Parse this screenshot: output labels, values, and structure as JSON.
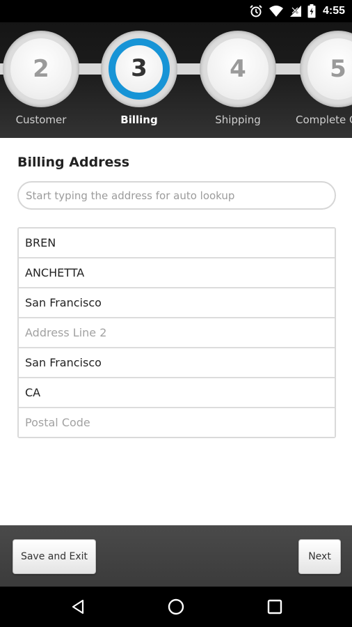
{
  "status_bar": {
    "time": "4:55",
    "icons": [
      "alarm-icon",
      "wifi-icon",
      "no-signal-icon",
      "battery-icon"
    ]
  },
  "stepper": {
    "steps": [
      {
        "number": "2",
        "label": "Customer",
        "active": false
      },
      {
        "number": "3",
        "label": "Billing",
        "active": true
      },
      {
        "number": "4",
        "label": "Shipping",
        "active": false
      },
      {
        "number": "5",
        "label": "Complete Or",
        "active": false
      }
    ],
    "accent_color": "#1794d6"
  },
  "form": {
    "title": "Billing Address",
    "lookup_placeholder": "Start typing the address for auto lookup",
    "fields": [
      {
        "value": "BREN",
        "placeholder": ""
      },
      {
        "value": "ANCHETTA",
        "placeholder": ""
      },
      {
        "value": "San Francisco",
        "placeholder": ""
      },
      {
        "value": "",
        "placeholder": "Address Line 2"
      },
      {
        "value": "San Francisco",
        "placeholder": ""
      },
      {
        "value": "CA",
        "placeholder": ""
      },
      {
        "value": "",
        "placeholder": "Postal Code"
      }
    ]
  },
  "actions": {
    "save_label": "Save and Exit",
    "next_label": "Next"
  },
  "nav_bar": {
    "icons": [
      "back-icon",
      "home-icon",
      "recents-icon"
    ]
  }
}
